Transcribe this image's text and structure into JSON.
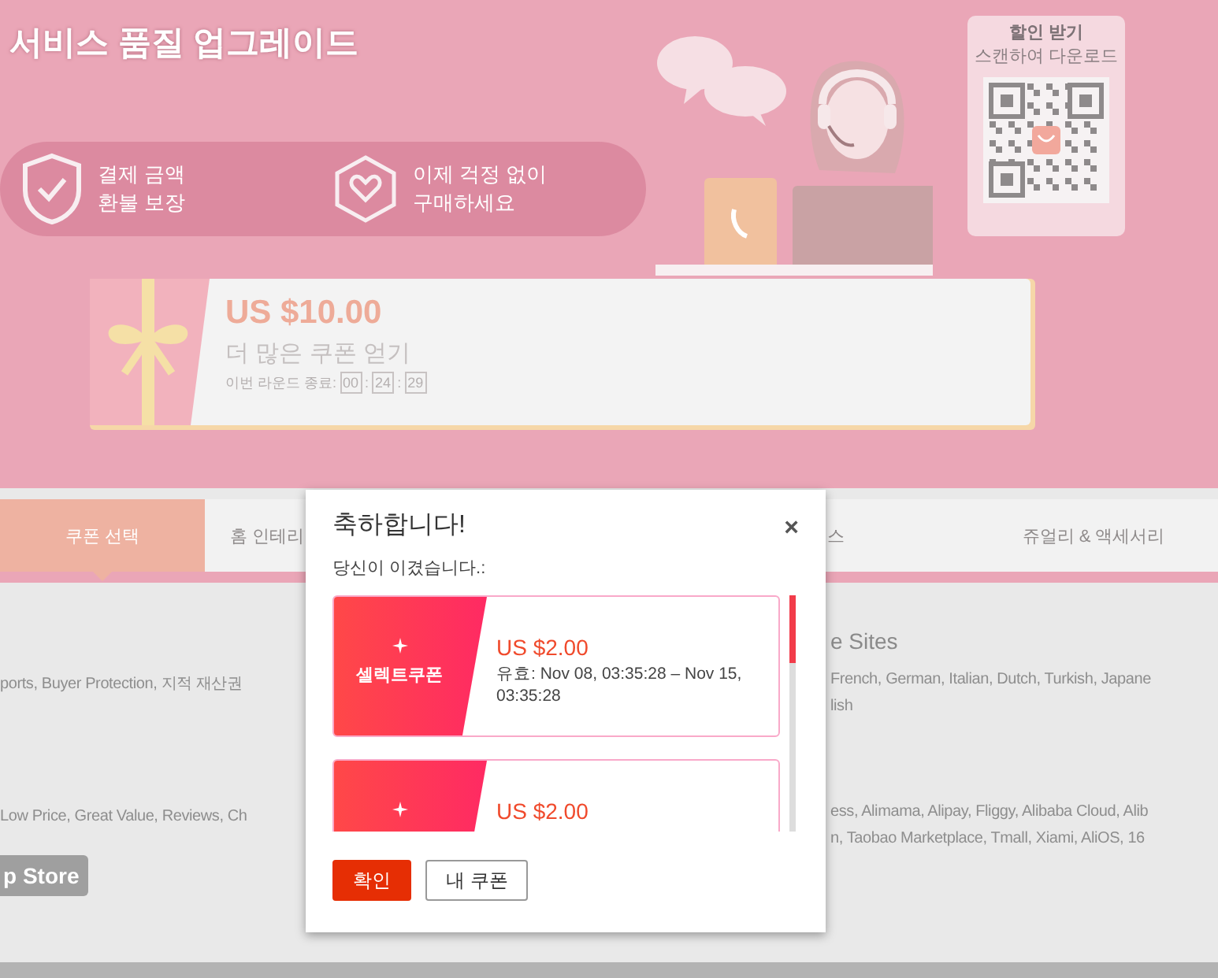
{
  "hero": {
    "title": "서비스 품질 업그레이드",
    "benefits": [
      {
        "kind": "shield",
        "lines": [
          "결제 금액",
          "환불 보장"
        ]
      },
      {
        "kind": "heart",
        "lines": [
          "이제 걱정 없이",
          "구매하세요"
        ]
      }
    ],
    "qr_card": {
      "title": "할인 받기",
      "subtitle": "스캔하여 다운로드"
    },
    "banner": {
      "amount": "US $10.00",
      "action": "더 많은 쿠폰 얻기",
      "countdown_label": "이번 라운드 종료:",
      "countdown": [
        {
          "kind": "box",
          "text": "00"
        },
        {
          "kind": "sep",
          "text": ":"
        },
        {
          "kind": "box",
          "text": "24"
        },
        {
          "kind": "sep",
          "text": ":"
        },
        {
          "kind": "box",
          "text": "29"
        }
      ]
    }
  },
  "tabs": [
    {
      "label": "쿠폰 선택",
      "selected": true
    },
    {
      "label": "홈 인테리",
      "selected": false
    },
    {
      "label": "스",
      "selected": false
    },
    {
      "label": "쥬얼리 & 액세서리",
      "selected": false
    }
  ],
  "content": {
    "left_lines": [
      "ports, Buyer Protection, 지적 재산권",
      "Low Price, Great Value, Reviews, Ch"
    ],
    "right_heading": "e Sites",
    "right_blocks": [
      [
        "French, German, Italian, Dutch, Turkish, Japane",
        "lish"
      ],
      [
        "ess, Alimama, Alipay, Fliggy, Alibaba Cloud, Alib",
        "n, Taobao Marketplace, Tmall, Xiami, AliOS, 16"
      ]
    ],
    "store_button": "p Store"
  },
  "dialog": {
    "title": "축하합니다!",
    "close": "×",
    "subtitle": "당신이 이겼습니다.:",
    "coupons": [
      {
        "label": "셀렉트쿠폰",
        "amount": "US $2.00",
        "validity": "유효: Nov 08, 03:35:28 – Nov 15, 03:35:28"
      },
      {
        "amount": "US $2.00"
      }
    ],
    "buttons": [
      {
        "kind": "primary",
        "label": "확인"
      },
      {
        "kind": "secondary",
        "label": "내 쿠폰"
      }
    ]
  }
}
